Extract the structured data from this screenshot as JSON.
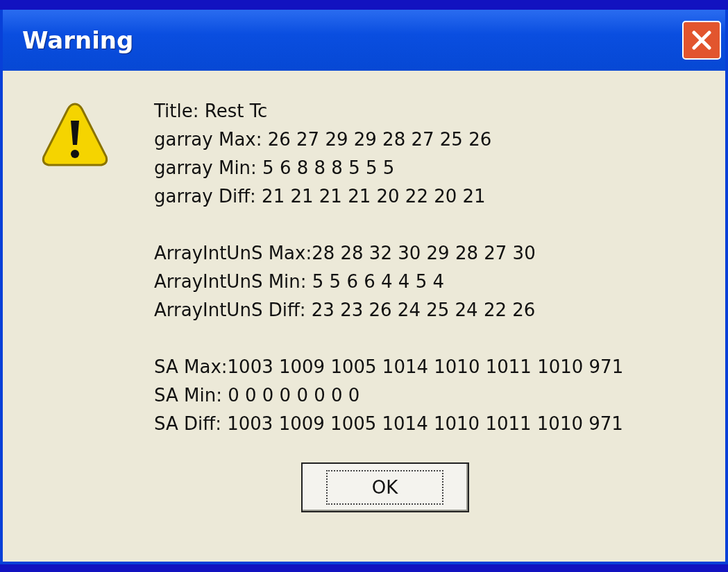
{
  "window": {
    "title": "Warning"
  },
  "message_blocks": [
    {
      "lines": [
        "Title: Rest Tc",
        "garray Max: 26 27 29 29 28 27 25 26",
        "garray Min: 5 6 8 8 8 5 5 5",
        "garray Diff: 21 21 21 21 20 22 20 21"
      ]
    },
    {
      "lines": [
        "ArrayIntUnS Max:28 28 32 30 29 28 27 30",
        "ArrayIntUnS Min: 5 5 6 6 4 4 5 4",
        "ArrayIntUnS Diff: 23 23 26 24 25 24 22 26"
      ]
    },
    {
      "lines": [
        "SA Max:1003 1009 1005 1014 1010 1011 1010 971",
        "SA Min: 0 0 0 0 0 0 0 0",
        "SA Diff: 1003 1009 1005 1014 1010 1011 1010 971"
      ]
    }
  ],
  "buttons": [
    "OK"
  ]
}
